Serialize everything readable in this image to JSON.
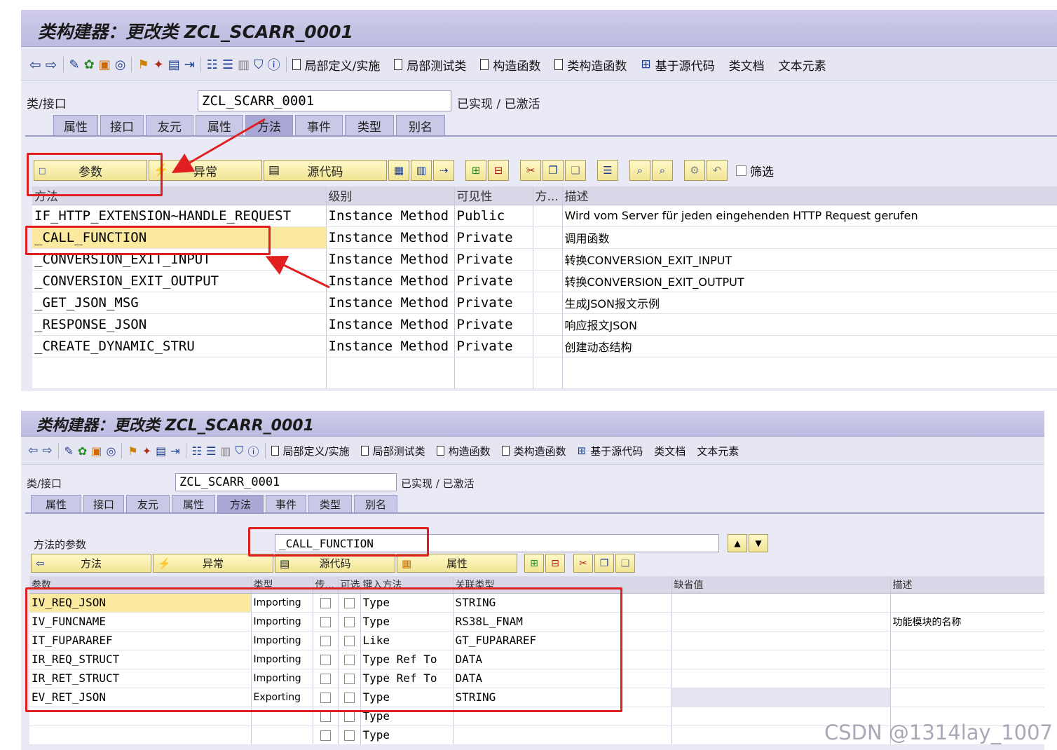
{
  "top": {
    "title": "类构建器：更改类 ZCL_SCARR_0001",
    "toolbar_links": [
      "局部定义/实施",
      "局部测试类",
      "构造函数",
      "类构造函数",
      "基于源代码",
      "类文档",
      "文本元素"
    ],
    "class_label": "类/接口",
    "class_value": "ZCL_SCARR_0001",
    "status": "已实现 / 已激活",
    "tabs": [
      "属性",
      "接口",
      "友元",
      "属性",
      "方法",
      "事件",
      "类型",
      "别名"
    ],
    "active_tab": "方法",
    "buttons": {
      "params": "参数",
      "exceptions": "异常",
      "source": "源代码"
    },
    "filter_label": "筛选",
    "columns": [
      "方法",
      "级别",
      "可见性",
      "方...",
      "描述"
    ],
    "rows": [
      {
        "method": "IF_HTTP_EXTENSION~HANDLE_REQUEST",
        "level": "Instance Method",
        "visibility": "Public",
        "desc": "Wird vom Server für jeden eingehenden HTTP Request gerufen"
      },
      {
        "method": "_CALL_FUNCTION",
        "level": "Instance Method",
        "visibility": "Private",
        "desc": "调用函数"
      },
      {
        "method": "_CONVERSION_EXIT_INPUT",
        "level": "Instance Method",
        "visibility": "Private",
        "desc": "转换CONVERSION_EXIT_INPUT"
      },
      {
        "method": "_CONVERSION_EXIT_OUTPUT",
        "level": "Instance Method",
        "visibility": "Private",
        "desc": "转换CONVERSION_EXIT_OUTPUT"
      },
      {
        "method": "_GET_JSON_MSG",
        "level": "Instance Method",
        "visibility": "Private",
        "desc": "生成JSON报文示例"
      },
      {
        "method": "_RESPONSE_JSON",
        "level": "Instance Method",
        "visibility": "Private",
        "desc": "响应报文JSON"
      },
      {
        "method": "_CREATE_DYNAMIC_STRU",
        "level": "Instance Method",
        "visibility": "Private",
        "desc": "创建动态结构"
      }
    ]
  },
  "bottom": {
    "title": "类构建器：更改类 ZCL_SCARR_0001",
    "toolbar_links": [
      "局部定义/实施",
      "局部测试类",
      "构造函数",
      "类构造函数",
      "基于源代码",
      "类文档",
      "文本元素"
    ],
    "class_label": "类/接口",
    "class_value": "ZCL_SCARR_0001",
    "status": "已实现 / 已激活",
    "tabs": [
      "属性",
      "接口",
      "友元",
      "属性",
      "方法",
      "事件",
      "类型",
      "别名"
    ],
    "active_tab": "方法",
    "method_params_label": "方法的参数",
    "method_name": "_CALL_FUNCTION",
    "buttons": {
      "method": "方法",
      "exceptions": "异常",
      "source": "源代码",
      "attributes": "属性"
    },
    "columns": [
      "参数",
      "类型",
      "传...",
      "可选",
      "键入方法",
      "关联类型",
      "缺省值",
      "描述"
    ],
    "rows": [
      {
        "param": "IV_REQ_JSON",
        "type": "Importing",
        "typing": "Type",
        "assoc": "STRING",
        "default": "",
        "desc": ""
      },
      {
        "param": "IV_FUNCNAME",
        "type": "Importing",
        "typing": "Type",
        "assoc": "RS38L_FNAM",
        "default": "",
        "desc": "功能模块的名称"
      },
      {
        "param": "IT_FUPARAREF",
        "type": "Importing",
        "typing": "Like",
        "assoc": "GT_FUPARAREF",
        "default": "",
        "desc": ""
      },
      {
        "param": "IR_REQ_STRUCT",
        "type": "Importing",
        "typing": "Type Ref To",
        "assoc": "DATA",
        "default": "",
        "desc": ""
      },
      {
        "param": "IR_RET_STRUCT",
        "type": "Importing",
        "typing": "Type Ref To",
        "assoc": "DATA",
        "default": "",
        "desc": ""
      },
      {
        "param": "EV_RET_JSON",
        "type": "Exporting",
        "typing": "Type",
        "assoc": "STRING",
        "default": "",
        "desc": ""
      },
      {
        "param": "",
        "type": "",
        "typing": "Type",
        "assoc": "",
        "default": "",
        "desc": ""
      },
      {
        "param": "",
        "type": "",
        "typing": "Type",
        "assoc": "",
        "default": "",
        "desc": ""
      }
    ]
  },
  "watermark": "CSDN @1314lay_1007",
  "colors": {
    "annotation_red": "#e02020",
    "highlight_yellow": "#fbe9a0",
    "sap_lavender": "#eaeaf6"
  }
}
